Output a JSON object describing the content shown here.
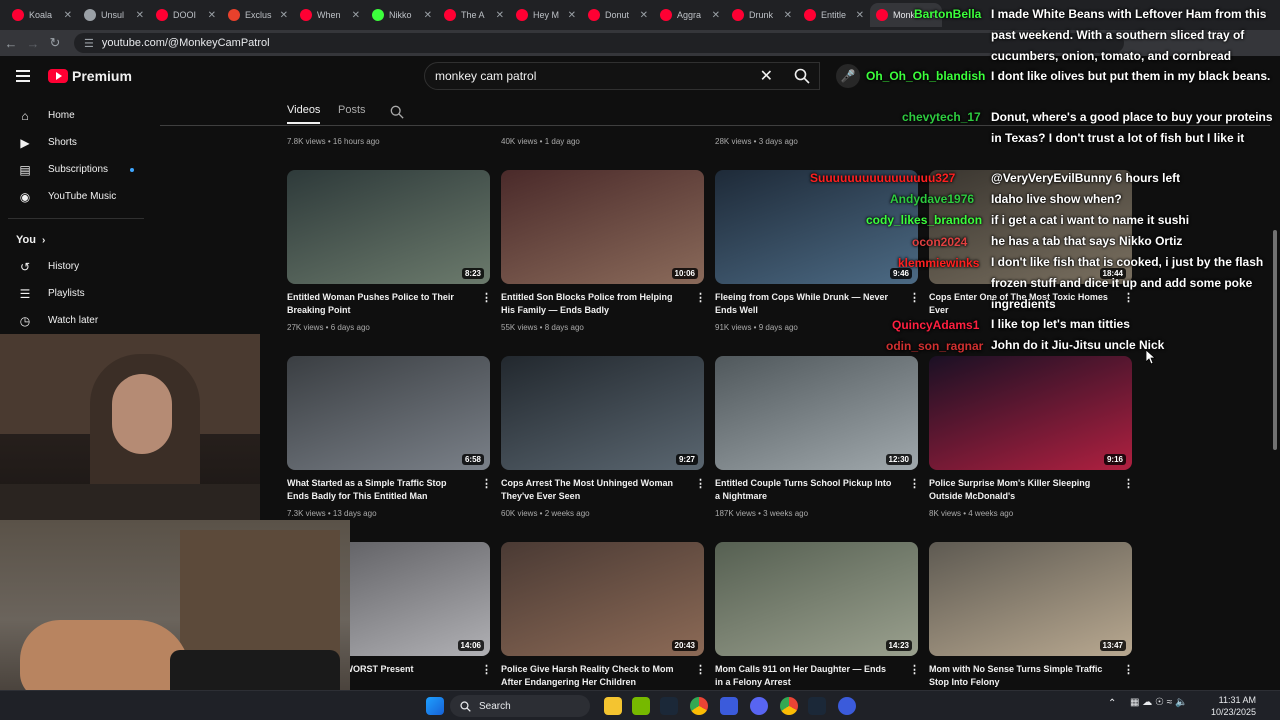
{
  "browser": {
    "tabs": [
      {
        "label": "Koala"
      },
      {
        "label": "Unsul"
      },
      {
        "label": "DOOI"
      },
      {
        "label": "Exclus"
      },
      {
        "label": "When"
      },
      {
        "label": "Nikko"
      },
      {
        "label": "The A"
      },
      {
        "label": "Hey M"
      },
      {
        "label": "Donut"
      },
      {
        "label": "Aggra"
      },
      {
        "label": "Drunk"
      },
      {
        "label": "Entitle"
      },
      {
        "label": "Monk"
      }
    ],
    "url": "youtube.com/@MonkeyCamPatrol"
  },
  "youtube": {
    "logo_text": "Premium",
    "search_value": "monkey cam patrol",
    "sidebar": {
      "items": [
        {
          "label": "Home",
          "icon": "home-icon"
        },
        {
          "label": "Shorts",
          "icon": "shorts-icon"
        },
        {
          "label": "Subscriptions",
          "icon": "subscriptions-icon"
        },
        {
          "label": "YouTube Music",
          "icon": "youtube-music-icon"
        }
      ],
      "you_heading": "You",
      "you_items": [
        {
          "label": "History",
          "icon": "history-icon"
        },
        {
          "label": "Playlists",
          "icon": "playlists-icon"
        },
        {
          "label": "Watch later",
          "icon": "watch-later-icon"
        }
      ]
    },
    "channel_tabs": {
      "videos": "Videos",
      "posts": "Posts"
    },
    "top_row_meta": [
      "7.8K views • 16 hours ago",
      "40K views • 1 day ago",
      "28K views • 3 days ago"
    ],
    "videos": [
      {
        "title": "Entitled Woman Pushes Police to Their Breaking Point",
        "meta": "27K views • 6 days ago",
        "duration": "8:23"
      },
      {
        "title": "Entitled Son Blocks Police from Helping His Family — Ends Badly",
        "meta": "55K views • 8 days ago",
        "duration": "10:06"
      },
      {
        "title": "Fleeing from Cops While Drunk — Never Ends Well",
        "meta": "91K views • 9 days ago",
        "duration": "9:46"
      },
      {
        "title": "Cops Enter One of The Most Toxic Homes Ever",
        "meta": "",
        "duration": "18:44"
      },
      {
        "title": "What Started as a Simple Traffic Stop Ends Badly for This Entitled Man",
        "meta": "7.3K views • 13 days ago",
        "duration": "6:58"
      },
      {
        "title": "Cops Arrest The Most Unhinged Woman They've Ever Seen",
        "meta": "60K views • 2 weeks ago",
        "duration": "9:27"
      },
      {
        "title": "Entitled Couple Turns School Pickup Into a Nightmare",
        "meta": "187K views • 3 weeks ago",
        "duration": "12:30"
      },
      {
        "title": "Police Surprise Mom's Killer Sleeping Outside McDonald's",
        "meta": "8K views • 4 weeks ago",
        "duration": "9:16"
      },
      {
        "title": "hday Girl the WORST Present",
        "meta": "",
        "duration": "14:06"
      },
      {
        "title": "Police Give Harsh Reality Check to Mom After Endangering Her Children",
        "meta": "",
        "duration": "20:43"
      },
      {
        "title": "Mom Calls 911 on Her Daughter — Ends in a Felony Arrest",
        "meta": "",
        "duration": "14:23"
      },
      {
        "title": "Mom with No Sense Turns Simple Traffic Stop Into Felony",
        "meta": "",
        "duration": "13:47"
      }
    ]
  },
  "chat": {
    "users": [
      {
        "name": "BartonBella",
        "color": "#3cff3c"
      },
      {
        "name": "Oh_Oh_Oh_blandish",
        "color": "#3cff3c"
      },
      {
        "name": "chevytech_17",
        "color": "#2ecc40"
      },
      {
        "name": "Suuuuuuuuuuuuuuuu327",
        "color": "#ff2020"
      },
      {
        "name": "Andydave1976",
        "color": "#2ecc40"
      },
      {
        "name": "cody_likes_brandon",
        "color": "#3cff3c"
      },
      {
        "name": "ocon2024",
        "color": "#e04040"
      },
      {
        "name": "klemmiewinks",
        "color": "#ff2020"
      },
      {
        "name": "QuincyAdams1",
        "color": "#ff2040"
      },
      {
        "name": "odin_son_ragnar",
        "color": "#d03030"
      }
    ],
    "messages": [
      "I made White Beans with Leftover Ham from this past weekend. With a southern sliced tray of cucumbers, onion, tomato, and cornbread",
      "I dont like olives but put them in my black beans.",
      "Donut, where's a good place to buy your proteins in Texas? I don't trust a lot of fish but I like it",
      "@VeryVeryEvilBunny 6 hours left",
      "Idaho live show when?",
      "if i get a cat i want to name it sushi",
      "he has a tab that says Nikko Ortiz",
      "I don't like fish that is cooked, i just by the flash frozen stuff and dice it up and add some poke ingredients",
      "I like top let's man titties",
      "John do it Jiu-Jitsu uncle Nick"
    ]
  },
  "taskbar": {
    "search_label": "Search",
    "time": "11:31 AM",
    "date": "10/23/2025"
  }
}
